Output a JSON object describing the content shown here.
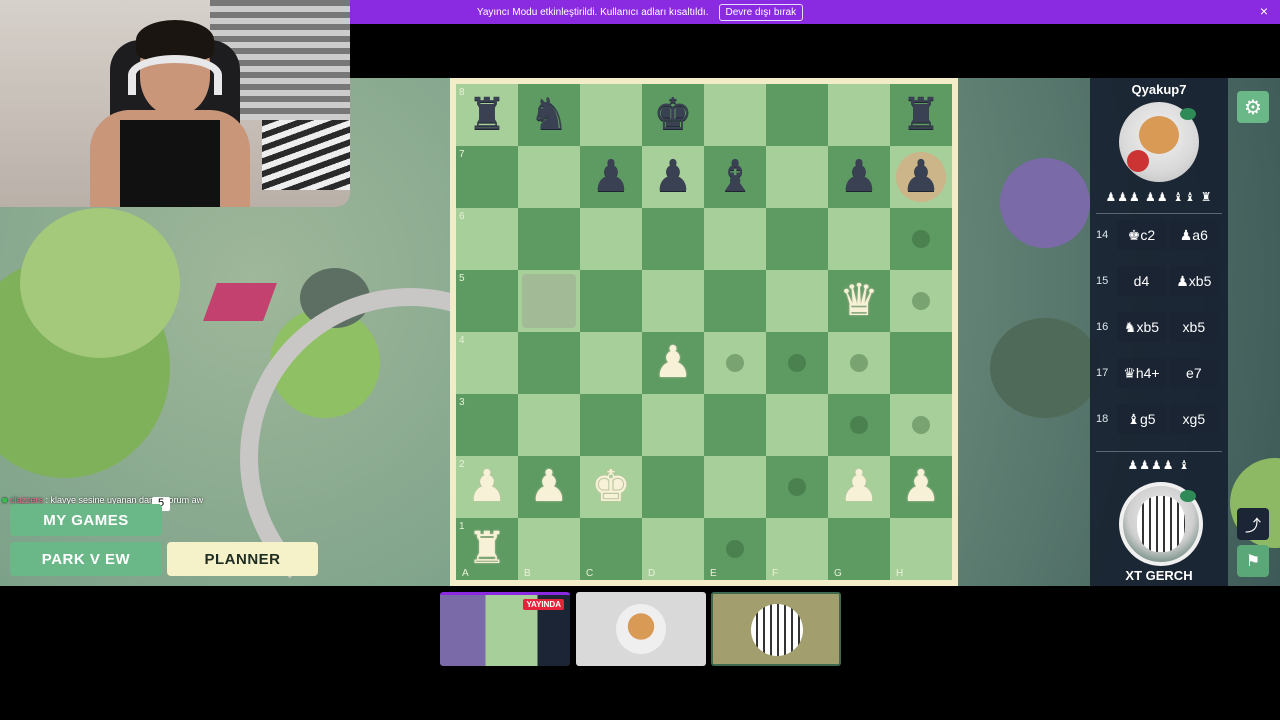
{
  "banner": {
    "message": "Yayıncı Modu etkinleştirildi. Kullanıcı adları kısaltıldı.",
    "disable_label": "Devre dışı bırak",
    "close_icon": "×"
  },
  "left_menu": {
    "my_games_label": "MY GAMES",
    "park_view_label": "PARK V EW",
    "planner_label": "PLANNER"
  },
  "chat": {
    "user": "clazzers",
    "text": ": klavye sesine uyanan dan... yorum aw",
    "badge_count": "5"
  },
  "board": {
    "ranks": [
      "8",
      "7",
      "6",
      "5",
      "4",
      "3",
      "2",
      "1"
    ],
    "files": [
      "A",
      "B",
      "C",
      "D",
      "E",
      "F",
      "G",
      "H"
    ],
    "pieces": [
      {
        "sq": "a8",
        "glyph": "♜",
        "color": "black"
      },
      {
        "sq": "b8",
        "glyph": "♞",
        "color": "black"
      },
      {
        "sq": "d8",
        "glyph": "♚",
        "color": "black"
      },
      {
        "sq": "h8",
        "glyph": "♜",
        "color": "black"
      },
      {
        "sq": "c7",
        "glyph": "♟",
        "color": "black"
      },
      {
        "sq": "d7",
        "glyph": "♟",
        "color": "black"
      },
      {
        "sq": "e7",
        "glyph": "♝",
        "color": "black"
      },
      {
        "sq": "g7",
        "glyph": "♟",
        "color": "black"
      },
      {
        "sq": "h7",
        "glyph": "♟",
        "color": "black"
      },
      {
        "sq": "g5",
        "glyph": "♛",
        "color": "white"
      },
      {
        "sq": "d4",
        "glyph": "♟",
        "color": "white"
      },
      {
        "sq": "a2",
        "glyph": "♟",
        "color": "white"
      },
      {
        "sq": "b2",
        "glyph": "♟",
        "color": "white"
      },
      {
        "sq": "c2",
        "glyph": "♚",
        "color": "white"
      },
      {
        "sq": "g2",
        "glyph": "♟",
        "color": "white"
      },
      {
        "sq": "h2",
        "glyph": "♟",
        "color": "white"
      },
      {
        "sq": "a1",
        "glyph": "♜",
        "color": "white"
      }
    ],
    "move_dots": [
      "h6",
      "h5",
      "e4",
      "f4",
      "g4",
      "g3",
      "h3",
      "f2",
      "e1"
    ],
    "highlight": "b5",
    "last_move_square": "h7"
  },
  "opponent": {
    "name": "Qyakup7",
    "captured": "♟♟♟ ♟♟ ♝♝ ♜"
  },
  "player": {
    "name": "XT GERCH",
    "captured": "♟♟♟♟ ♝"
  },
  "moves": [
    {
      "num": "14",
      "white": "♚c2",
      "black": "♟a6"
    },
    {
      "num": "15",
      "white": "d4",
      "black": "♟xb5"
    },
    {
      "num": "16",
      "white": "♞xb5",
      "black": "xb5"
    },
    {
      "num": "17",
      "white": "♛h4+",
      "black": "e7"
    },
    {
      "num": "18",
      "white": "♝g5",
      "black": "xg5"
    }
  ],
  "thumbs": {
    "live_label": "YAYINDA"
  },
  "icons": {
    "settings": "gear-icon",
    "share": "share-icon",
    "flag": "flag-icon",
    "eye": "eye-icon"
  }
}
